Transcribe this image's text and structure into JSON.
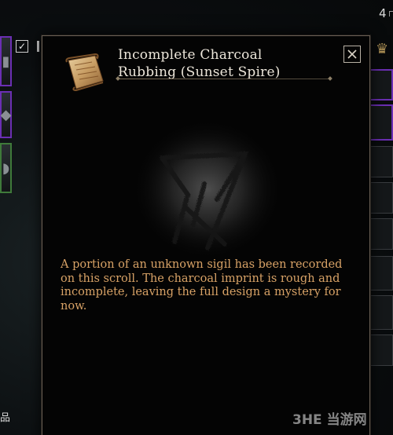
{
  "item": {
    "title_line1": "Incomplete Charcoal",
    "title_line2": "Rubbing (Sunset Spire)",
    "description": "A portion of an unknown sigil has been recorded on this scroll. The charcoal imprint is rough and incomplete, leaving the full design a mystery for now.",
    "icon": "parchment-scroll-icon",
    "image": "charcoal-sigil-rubbing"
  },
  "inventory": {
    "stack_count": "4",
    "category_label": "品",
    "filter_checked": true
  },
  "watermark": "3HE 当游网",
  "colors": {
    "description_text": "#d8a266",
    "title_text": "#ece6da",
    "rare_border": "#6b2fb3",
    "uncommon_border": "#3f7a3a",
    "panel_border": "#6a6055"
  }
}
